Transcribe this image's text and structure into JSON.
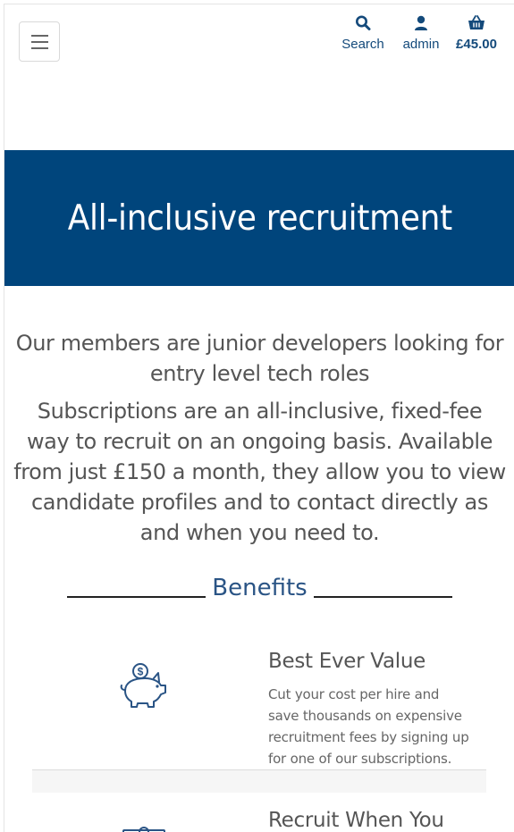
{
  "header": {
    "menu_icon": "hamburger-menu-icon",
    "search": {
      "icon": "search-icon",
      "label": "Search"
    },
    "account": {
      "icon": "user-icon",
      "label": "admin"
    },
    "basket": {
      "icon": "basket-icon",
      "label": "£45.00"
    },
    "accent_color": "#144a7b"
  },
  "hero": {
    "title": "All-inclusive recruitment",
    "background_color": "#00457c"
  },
  "intro": {
    "lead": "Our members are junior developers looking for entry level tech roles",
    "body": "Subscriptions are an all-inclusive, fixed-fee way to recruit on an ongoing basis. Available from just £150 a month, they allow you to view candidate profiles and to contact directly as and when you need to."
  },
  "benefits": {
    "heading": "Benefits",
    "items": [
      {
        "icon": "piggy-bank-icon",
        "title": "Best Ever Value",
        "text": "Cut your cost per hire and save thousands on expensive recruitment fees by signing up for one of our subscriptions."
      },
      {
        "icon": "money-icon",
        "title": "Recruit When You"
      }
    ]
  }
}
